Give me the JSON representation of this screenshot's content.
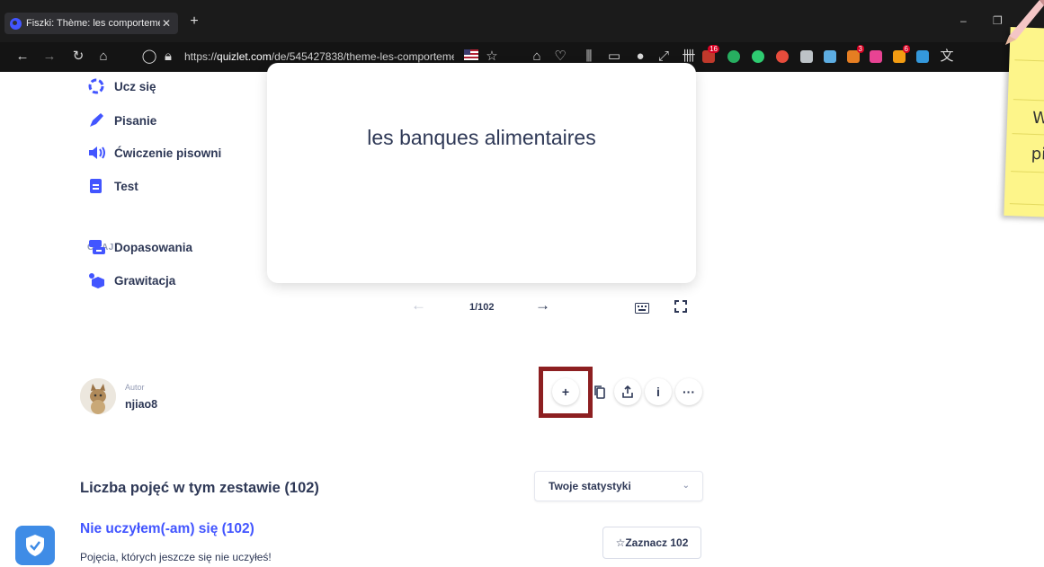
{
  "browser": {
    "tab_title": "Fiszki: Thème: les comporteme",
    "tab_close": "✕",
    "new_tab": "+",
    "url_prefix": "https://",
    "url_domain": "quizlet.com",
    "url_path": "/de/545427838/theme-les-comporteme",
    "win_minimize": "–",
    "win_restore": "❐",
    "extension_badges": {
      "badge_1": "16",
      "badge_2": "3",
      "badge_3": "6"
    },
    "icons": [
      "back-icon",
      "forward-icon",
      "reload-icon",
      "home-icon",
      "shield-icon",
      "lock-icon",
      "flag-icon",
      "star-icon"
    ]
  },
  "sidebar": {
    "study": [
      {
        "label": "Ucz się",
        "icon": "learn-icon"
      },
      {
        "label": "Pisanie",
        "icon": "write-icon"
      },
      {
        "label": "Ćwiczenie pisowni",
        "icon": "spell-icon"
      },
      {
        "label": "Test",
        "icon": "test-icon"
      }
    ],
    "play_heading": "GRAJ",
    "play": [
      {
        "label": "Dopasowania",
        "icon": "match-icon"
      },
      {
        "label": "Grawitacja",
        "icon": "gravity-icon"
      }
    ]
  },
  "flashcard": {
    "term": "les banques alimentaires",
    "counter": "1/102",
    "prev_arrow": "←",
    "next_arrow": "→"
  },
  "author": {
    "label": "Autor",
    "name": "njiao8"
  },
  "actions": {
    "add": "+",
    "info": "i",
    "more": "···"
  },
  "terms": {
    "title": "Liczba pojęć w tym zestawie (102)",
    "stats_select": "Twoje statystyki",
    "section_title": "Nie uczyłem(-am) się (102)",
    "section_desc": "Pojęcia, których jeszcze się nie uczyłeś!",
    "mark_button": "☆Zaznacz 102"
  },
  "sticky_note": {
    "line1": "W",
    "line2": "pi"
  },
  "colors": {
    "accent": "#4255ff",
    "text": "#2e3856",
    "muted": "#939bb4",
    "highlight_box": "#8d1f21",
    "note": "#fdf58a"
  }
}
